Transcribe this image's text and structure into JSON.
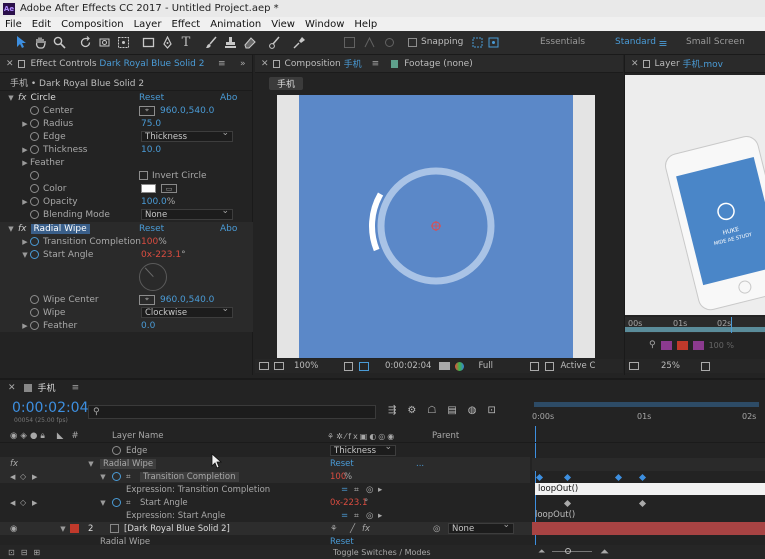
{
  "app": {
    "title": "Adobe After Effects CC 2017 - Untitled Project.aep *",
    "logo": "Ae"
  },
  "menu": [
    "File",
    "Edit",
    "Composition",
    "Layer",
    "Effect",
    "Animation",
    "View",
    "Window",
    "Help"
  ],
  "toolbar": {
    "snapping_label": "Snapping",
    "workspaces": [
      "Essentials",
      "Standard",
      "Small Screen"
    ],
    "active_workspace": "Standard"
  },
  "effect_controls": {
    "tab_prefix": "Effect Controls",
    "tab_layer": "Dark Royal Blue Solid 2",
    "breadcrumb": "手机 • Dark Royal Blue Solid 2",
    "circle": {
      "name": "Circle",
      "reset": "Reset",
      "about": "Abo",
      "center_label": "Center",
      "center_value": "960.0,540.0",
      "radius_label": "Radius",
      "radius_value": "75.0",
      "edge_label": "Edge",
      "edge_value": "Thickness",
      "thickness_label": "Thickness",
      "thickness_value": "10.0",
      "feather_label": "Feather",
      "invert_label": "Invert Circle",
      "color_label": "Color",
      "opacity_label": "Opacity",
      "opacity_value": "100.0",
      "opacity_unit": "%",
      "blend_label": "Blending Mode",
      "blend_value": "None"
    },
    "radial_wipe": {
      "name": "Radial Wipe",
      "reset": "Reset",
      "about": "Abo",
      "transition_label": "Transition Completion",
      "transition_value": "100",
      "transition_unit": "%",
      "start_angle_label": "Start Angle",
      "start_angle_prefix": "0x",
      "start_angle_value": "-223.1",
      "start_angle_unit": "°",
      "wipe_center_label": "Wipe Center",
      "wipe_center_value": "960.0,540.0",
      "wipe_label": "Wipe",
      "wipe_value": "Clockwise",
      "feather_label": "Feather",
      "feather_value": "0.0"
    }
  },
  "composition": {
    "tab_prefix": "Composition",
    "tab_name": "手机",
    "footage_tab": "Footage (none)",
    "subtab": "手机",
    "zoom": "100%",
    "timecode": "0:00:02:04",
    "resolution": "Full",
    "active_camera": "Active C",
    "ring_progress_pct": 100,
    "wipe_arc_start_angle": -223.1
  },
  "layer_panel": {
    "tab_prefix": "Layer",
    "tab_name": "手机.mov",
    "phone_text_line1": "HUKE",
    "phone_text_line2": "MIDE AE STUDY",
    "ruler_ticks": [
      "00s",
      "01s",
      "02s"
    ],
    "zoom": "25%",
    "opacity_readout": "100 %"
  },
  "timeline": {
    "tab_name": "手机",
    "timecode": "0:00:02:04",
    "frame_info": "00054 (25.00 fps)",
    "search_placeholder": "",
    "col_num": "#",
    "col_layer_name": "Layer Name",
    "col_parent": "Parent",
    "ruler_ticks": [
      "0:00s",
      "01s",
      "02s"
    ],
    "rows": {
      "edge_label": "Edge",
      "edge_value": "Thickness",
      "fx_label": "fx",
      "radial_wipe": "Radial Wipe",
      "reset": "Reset",
      "ellipsis": "...",
      "transition": "Transition Completion",
      "transition_value": "100",
      "transition_unit": "%",
      "expr_transition": "Expression: Transition Completion",
      "expr_transition_text": "loopOut()",
      "start_angle": "Start Angle",
      "start_angle_prefix": "0x",
      "start_angle_value": "-223.1",
      "start_angle_unit": "°",
      "expr_start": "Expression: Start Angle",
      "expr_start_text": "loopOut()",
      "layer_num": "2",
      "layer_name": "[Dark Royal Blue Solid 2]",
      "parent_value": "None",
      "next_effect": "Radial Wipe",
      "next_reset": "Reset"
    },
    "toggle_label": "Toggle Switches / Modes"
  },
  "colors": {
    "comp_bg": "#5b88c8",
    "label_red": "#c0392b",
    "accent_blue": "#4a9bd6",
    "value_red": "#d94c40"
  },
  "icons": [
    "selection-icon",
    "hand-icon",
    "zoom-icon",
    "rotate-icon",
    "camera-orbit-icon",
    "pan-behind-icon",
    "rectangle-icon",
    "pen-icon",
    "type-icon",
    "brush-icon",
    "clone-stamp-icon",
    "eraser-icon",
    "roto-brush-icon",
    "puppet-pin-icon"
  ]
}
